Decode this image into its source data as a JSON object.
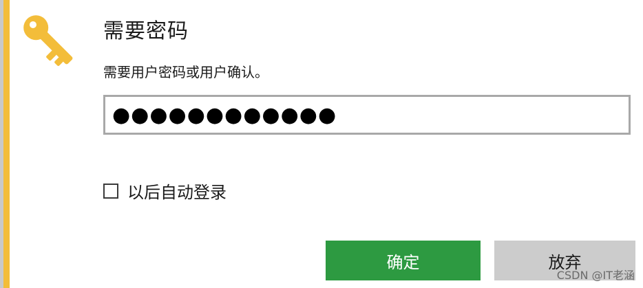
{
  "dialog": {
    "title": "需要密码",
    "message": "需要用户密码或用户确认。",
    "accent_color": "#f3bd3a",
    "key_icon": "key-icon"
  },
  "password": {
    "value": "●●●●●●●●●●●●"
  },
  "remember": {
    "checked": false,
    "label": "以后自动登录"
  },
  "buttons": {
    "ok_label": "确定",
    "ok_color": "#2d9a41",
    "cancel_label": "放弃",
    "cancel_color": "#cccccc"
  },
  "watermark": "CSDN @IT老涵"
}
